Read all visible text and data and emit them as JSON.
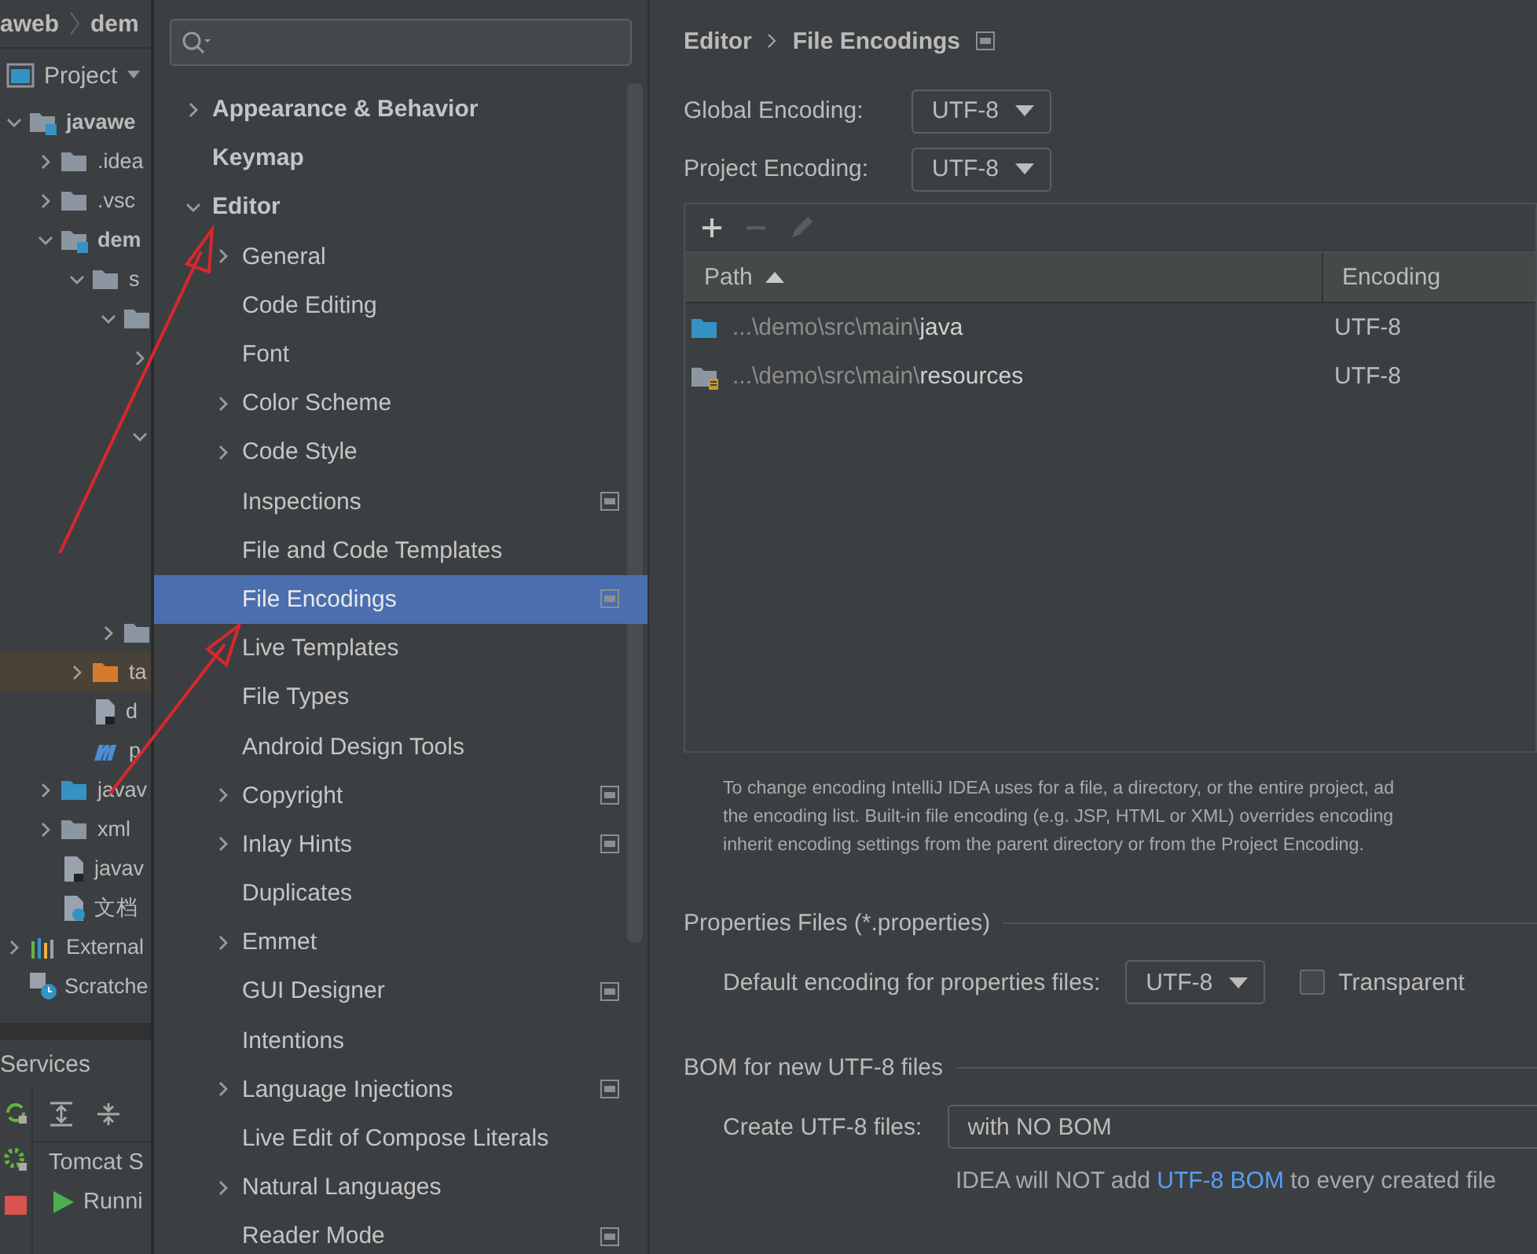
{
  "project_panel": {
    "breadcrumb": [
      "aweb",
      "dem"
    ],
    "title": "Project",
    "tree": [
      {
        "label": "javawe",
        "kind": "module",
        "expanded": true,
        "highlighted": false,
        "children": [
          {
            "label": ".idea",
            "kind": "folder",
            "expanded": false,
            "highlighted": false
          },
          {
            "label": ".vsc",
            "kind": "folder",
            "expanded": false,
            "highlighted": false
          },
          {
            "label": "dem",
            "kind": "module",
            "expanded": true,
            "highlighted": false,
            "children": [
              {
                "label": "s",
                "kind": "folder",
                "expanded": true,
                "highlighted": false,
                "children": [
                  {
                    "kind": "folder",
                    "expanded": true,
                    "children": [
                      {
                        "expanded": false
                      },
                      {
                        "expanded": true
                      }
                    ]
                  },
                  {
                    "kind": "folder",
                    "expanded": false
                  }
                ]
              },
              {
                "label": "ta",
                "kind": "excluded-folder",
                "expanded": false,
                "highlighted": true
              },
              {
                "label": "d",
                "kind": "file",
                "highlighted": false
              },
              {
                "label": "p",
                "kind": "maven",
                "highlighted": false
              }
            ]
          },
          {
            "label": "javav",
            "kind": "source-folder",
            "expanded": false,
            "highlighted": false
          },
          {
            "label": "xml",
            "kind": "folder",
            "expanded": false,
            "highlighted": false
          },
          {
            "label": "javav",
            "kind": "file",
            "highlighted": false
          },
          {
            "label": "文档",
            "kind": "help-file",
            "highlighted": false
          }
        ]
      },
      {
        "label": "External",
        "kind": "libraries",
        "expanded": false,
        "highlighted": false
      },
      {
        "label": "Scratche",
        "kind": "scratch",
        "highlighted": false
      }
    ]
  },
  "services_panel": {
    "title": "Services",
    "items": [
      {
        "label": "Tomcat S",
        "kind": "group"
      },
      {
        "label": "Runni",
        "kind": "running"
      }
    ]
  },
  "settings": {
    "tree": [
      {
        "label": "Appearance & Behavior",
        "expanded": false,
        "selected": false,
        "scoped": false
      },
      {
        "label": "Keymap",
        "selected": false,
        "scoped": false
      },
      {
        "label": "Editor",
        "expanded": true,
        "selected": false,
        "scoped": false,
        "children": [
          {
            "label": "General",
            "expanded": false,
            "selected": false,
            "scoped": false
          },
          {
            "label": "Code Editing",
            "selected": false,
            "scoped": false
          },
          {
            "label": "Font",
            "selected": false,
            "scoped": false
          },
          {
            "label": "Color Scheme",
            "expanded": false,
            "selected": false,
            "scoped": false
          },
          {
            "label": "Code Style",
            "expanded": false,
            "selected": false,
            "scoped": false
          },
          {
            "label": "Inspections",
            "selected": false,
            "scoped": true
          },
          {
            "label": "File and Code Templates",
            "selected": false,
            "scoped": false
          },
          {
            "label": "File Encodings",
            "selected": true,
            "scoped": true
          },
          {
            "label": "Live Templates",
            "selected": false,
            "scoped": false
          },
          {
            "label": "File Types",
            "selected": false,
            "scoped": false
          },
          {
            "label": "Android Design Tools",
            "selected": false,
            "scoped": false
          },
          {
            "label": "Copyright",
            "expanded": false,
            "selected": false,
            "scoped": true
          },
          {
            "label": "Inlay Hints",
            "expanded": false,
            "selected": false,
            "scoped": true
          },
          {
            "label": "Duplicates",
            "selected": false,
            "scoped": false
          },
          {
            "label": "Emmet",
            "expanded": false,
            "selected": false,
            "scoped": false
          },
          {
            "label": "GUI Designer",
            "selected": false,
            "scoped": true
          },
          {
            "label": "Intentions",
            "selected": false,
            "scoped": false
          },
          {
            "label": "Language Injections",
            "expanded": false,
            "selected": false,
            "scoped": true
          },
          {
            "label": "Live Edit of Compose Literals",
            "selected": false,
            "scoped": false
          },
          {
            "label": "Natural Languages",
            "expanded": false,
            "selected": false,
            "scoped": false
          },
          {
            "label": "Reader Mode",
            "selected": false,
            "scoped": true
          }
        ]
      }
    ],
    "breadcrumb": [
      "Editor",
      "File Encodings"
    ],
    "encodings": [
      {
        "label": "Global Encoding:",
        "value": "UTF-8"
      },
      {
        "label": "Project Encoding:",
        "value": "UTF-8"
      }
    ],
    "table": {
      "toolbar": [
        {
          "kind": "add",
          "disabled": false
        },
        {
          "kind": "remove",
          "disabled": true
        },
        {
          "kind": "edit",
          "disabled": true
        }
      ],
      "columns": [
        {
          "label": "Path",
          "sorted": true
        },
        {
          "label": "Encoding",
          "sorted": false
        }
      ],
      "rows": [
        {
          "kind": "sources",
          "path": "...\\demo\\src\\main\\java",
          "encoding": "UTF-8"
        },
        {
          "kind": "resources",
          "path": "...\\demo\\src\\main\\resources",
          "encoding": "UTF-8"
        }
      ]
    },
    "description": "To change encoding IntelliJ IDEA uses for a file, a directory, or the entire project, ad\nthe encoding list. Built-in file encoding (e.g. JSP, HTML or XML) overrides encoding\ninherit encoding settings from the parent directory or from the Project Encoding.",
    "properties_section": {
      "title": "Properties Files (*.properties)",
      "label": "Default encoding for properties files:",
      "value": "UTF-8",
      "checkbox": {
        "label": "Transparent",
        "checked": false
      }
    },
    "bom_section": {
      "title": "BOM for new UTF-8 files",
      "label": "Create UTF-8 files:",
      "value": "with NO BOM",
      "note": {
        "before": "IDEA will NOT add",
        "link": "UTF-8 BOM",
        "after": "to every created file"
      }
    }
  }
}
